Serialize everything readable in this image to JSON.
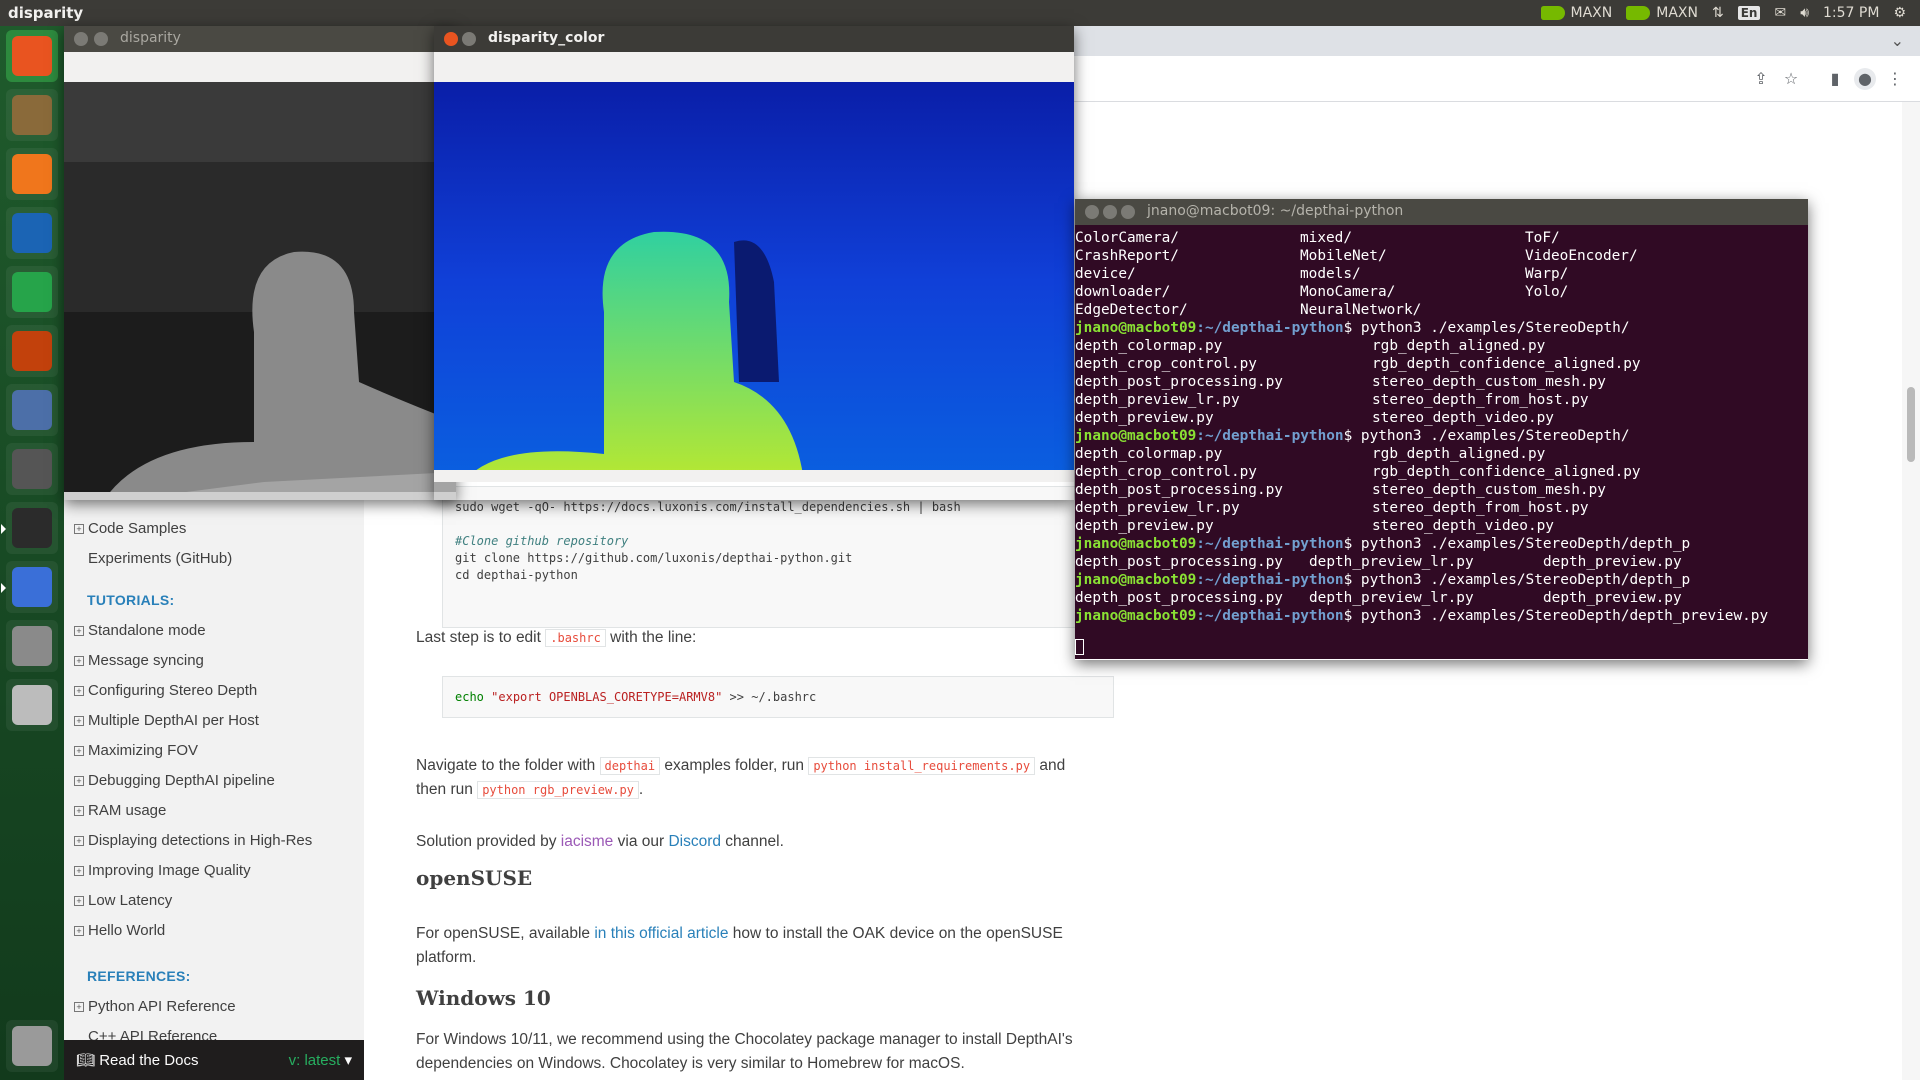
{
  "top_panel": {
    "app_title": "disparity",
    "tray": {
      "nvidia_mode_1": "MAXN",
      "nvidia_mode_2": "MAXN",
      "keyboard_layout": "En",
      "clock": "1:57 PM"
    }
  },
  "launcher": {
    "items": [
      "ubuntu-dash-icon",
      "files-icon",
      "firefox-icon",
      "writer-icon",
      "calc-icon",
      "impress-icon",
      "software-center-icon",
      "system-settings-icon",
      "terminal-icon",
      "chromium-icon",
      "help-icon",
      "drive-icon",
      "trash-icon"
    ]
  },
  "sidebar": {
    "items_top": [
      {
        "label": "Code Samples",
        "expand": true
      },
      {
        "label": "Experiments (GitHub)",
        "expand": false
      }
    ],
    "tutorials_caption": "TUTORIALS:",
    "tutorials": [
      {
        "label": "Standalone mode",
        "expand": true
      },
      {
        "label": "Message syncing",
        "expand": true
      },
      {
        "label": "Configuring Stereo Depth",
        "expand": true
      },
      {
        "label": "Multiple DepthAI per Host",
        "expand": true
      },
      {
        "label": "Maximizing FOV",
        "expand": true
      },
      {
        "label": "Debugging DepthAI pipeline",
        "expand": true
      },
      {
        "label": "RAM usage",
        "expand": true
      },
      {
        "label": "Displaying detections in High-Res",
        "expand": true
      },
      {
        "label": "Improving Image Quality",
        "expand": true
      },
      {
        "label": "Low Latency",
        "expand": true
      },
      {
        "label": "Hello World",
        "expand": true
      }
    ],
    "references_caption": "REFERENCES:",
    "references": [
      {
        "label": "Python API Reference",
        "expand": true
      },
      {
        "label": "C++ API Reference",
        "expand": false
      }
    ],
    "rtd_label": "Read the Docs",
    "rtd_version": "v: latest"
  },
  "content": {
    "code1_line1": "sudo wget -qO- https://docs.luxonis.com/install_dependencies.sh | bash",
    "code1_comment": "#Clone github repository",
    "code1_line2": "git clone https://github.com/luxonis/depthai-python.git",
    "code1_line3": "cd depthai-python",
    "last_step_before": "Last step is to edit ",
    "last_step_code": ".bashrc",
    "last_step_after": " with the line:",
    "code2_cmd": "echo",
    "code2_str": "\"export OPENBLAS_CORETYPE=ARMV8\"",
    "code2_rest": " >> ~/.bashrc",
    "nav_p1": "Navigate to the folder with ",
    "nav_code1": "depthai",
    "nav_p2": " examples folder, run ",
    "nav_code2": "python install_requirements.py",
    "nav_p3": " and",
    "nav_p4": "then run ",
    "nav_code3": "python rgb_preview.py",
    "nav_p5": ".",
    "solution_p1": "Solution provided by ",
    "solution_user": "iacisme",
    "solution_p2": " via our ",
    "solution_discord": "Discord",
    "solution_p3": " channel.",
    "opensuse_heading": "openSUSE",
    "opensuse_p1": "For openSUSE, available ",
    "opensuse_link": "in this official article",
    "opensuse_p2": " how to install the OAK device on the openSUSE",
    "opensuse_p3": "platform.",
    "windows_heading": "Windows 10",
    "windows_p1": "For Windows 10/11, we recommend using the Chocolatey package manager to install DepthAI's",
    "windows_p2": "dependencies on Windows. Chocolatey is very similar to Homebrew for macOS."
  },
  "windows": {
    "disparity_title": "disparity",
    "disparity_color_title": "disparity_color",
    "terminal_title": "jnano@macbot09: ~/depthai-python"
  },
  "terminal": {
    "prompt_user": "jnano@macbot09",
    "prompt_path": ":~/depthai-python",
    "dir_listing": [
      [
        "ColorCamera/",
        "mixed/",
        "ToF/"
      ],
      [
        "CrashReport/",
        "MobileNet/",
        "VideoEncoder/"
      ],
      [
        "device/",
        "models/",
        "Warp/"
      ],
      [
        "downloader/",
        "MonoCamera/",
        "Yolo/"
      ],
      [
        "EdgeDetector/",
        "NeuralNetwork/",
        ""
      ]
    ],
    "cmd_stereo": "$ python3 ./examples/StereoDepth/",
    "stereo_listing": [
      [
        "depth_colormap.py",
        "rgb_depth_aligned.py"
      ],
      [
        "depth_crop_control.py",
        "rgb_depth_confidence_aligned.py"
      ],
      [
        "depth_post_processing.py",
        "stereo_depth_custom_mesh.py"
      ],
      [
        "depth_preview_lr.py",
        "stereo_depth_from_host.py"
      ],
      [
        "depth_preview.py",
        "stereo_depth_video.py"
      ]
    ],
    "cmd_depth_p": "$ python3 ./examples/StereoDepth/depth_p",
    "depth_p_listing": [
      "depth_post_processing.py",
      "depth_preview_lr.py",
      "depth_preview.py"
    ],
    "cmd_final": "$ python3 ./examples/StereoDepth/depth_preview.py"
  }
}
